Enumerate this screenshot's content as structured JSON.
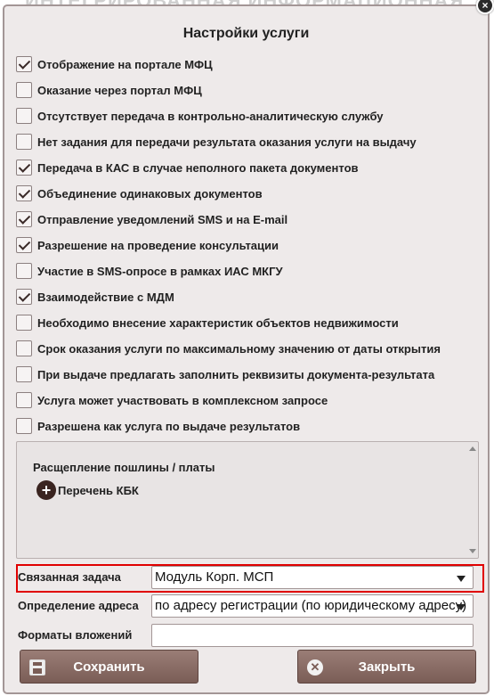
{
  "background_title": "ИНТЕГРИРОВАННАЯ ИНФОРМАЦИОННАЯ",
  "dialog": {
    "title": "Настройки услуги",
    "close_glyph": "×"
  },
  "options": [
    {
      "label": "Отображение на портале МФЦ",
      "checked": true
    },
    {
      "label": "Оказание через портал МФЦ",
      "checked": false
    },
    {
      "label": "Отсутствует передача в контрольно-аналитическую службу",
      "checked": false
    },
    {
      "label": "Нет задания для передачи результата оказания услуги на выдачу",
      "checked": false
    },
    {
      "label": "Передача в КАС в случае неполного пакета документов",
      "checked": true
    },
    {
      "label": "Объединение одинаковых документов",
      "checked": true
    },
    {
      "label": "Отправление уведомлений SMS и на E-mail",
      "checked": true
    },
    {
      "label": "Разрешение на проведение консультации",
      "checked": true
    },
    {
      "label": "Участие в SMS-опросе в рамках ИАС МКГУ",
      "checked": false
    },
    {
      "label": "Взаимодействие с МДМ",
      "checked": true
    },
    {
      "label": "Необходимо внесение характеристик объектов недвижимости",
      "checked": false
    },
    {
      "label": "Срок оказания услуги по максимальному значению от даты открытия",
      "checked": false
    },
    {
      "label": "При выдаче предлагать заполнить реквизиты документа-результата",
      "checked": false
    },
    {
      "label": "Услуга может участвовать в комплексном запросе",
      "checked": false
    },
    {
      "label": "Разрешена как услуга по выдаче результатов",
      "checked": false
    }
  ],
  "split": {
    "title": "Расщепление пошлины / платы",
    "kbk_label": "Перечень КБК",
    "kbk_icon": "plus-circle-icon"
  },
  "fields": {
    "related_task": {
      "label": "Связанная задача",
      "value": "Модуль Корп. МСП"
    },
    "address": {
      "label": "Определение адреса",
      "value": "по адресу регистрации (по юридическому адресу)"
    },
    "attachments": {
      "label": "Форматы вложений",
      "value": ""
    }
  },
  "buttons": {
    "save": "Сохранить",
    "close": "Закрыть"
  },
  "colors": {
    "dialog_bg": "#eeeaea",
    "button_bg": "#8a6d66",
    "highlight": "#e00000"
  }
}
